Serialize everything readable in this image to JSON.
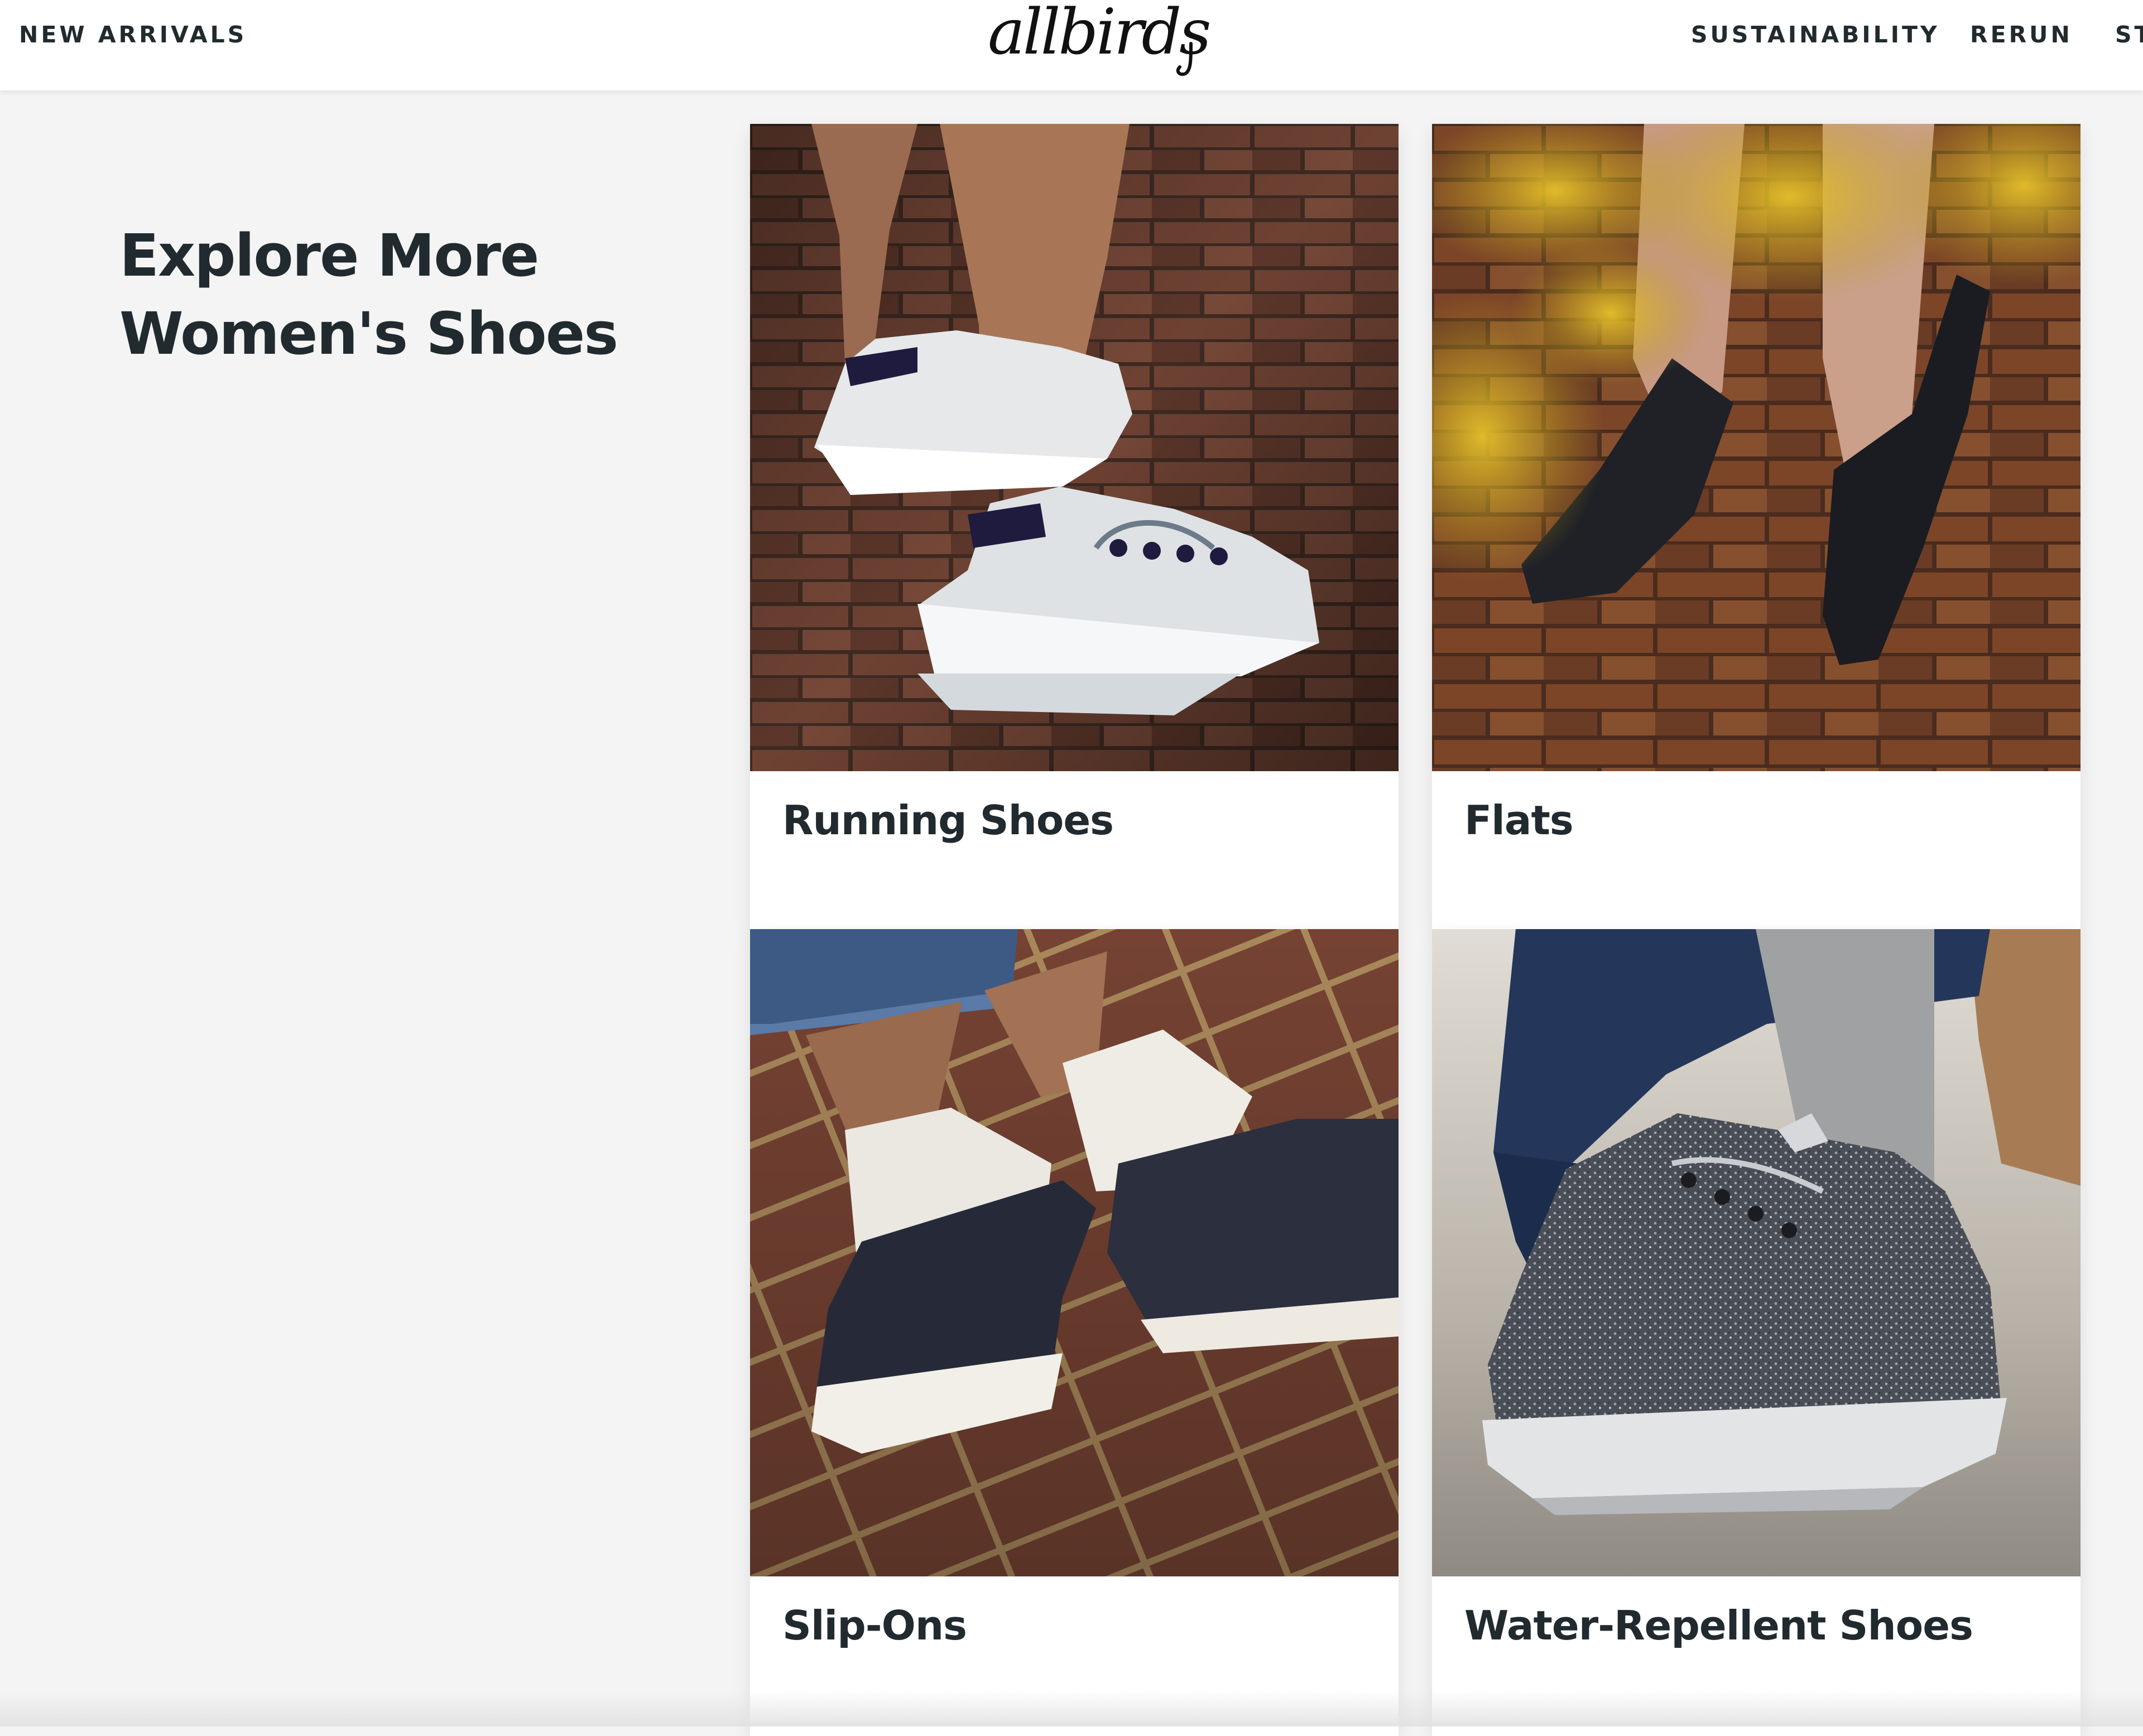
{
  "header": {
    "nav_left": "NEW ARRIVALS",
    "logo": "allbirds",
    "nav_right": [
      "SUSTAINABILITY",
      "RERUN",
      "ST"
    ]
  },
  "main": {
    "heading_line1": "Explore More",
    "heading_line2": "Women's Shoes",
    "cards": [
      {
        "label": "Running Shoes",
        "image": "white-knit-running-sneakers-on-brick"
      },
      {
        "label": "Flats",
        "image": "black-knit-flats-with-yellow-foliage"
      },
      {
        "label": "Slip-Ons",
        "image": "navy-wool-slip-ons-on-tiled-step"
      },
      {
        "label": "Water-Repellent Shoes",
        "image": "grey-wool-high-top-sneakers"
      }
    ]
  },
  "colors": {
    "text": "#212a2f",
    "page_background": "#f4f4f4",
    "card_background": "#ffffff"
  }
}
